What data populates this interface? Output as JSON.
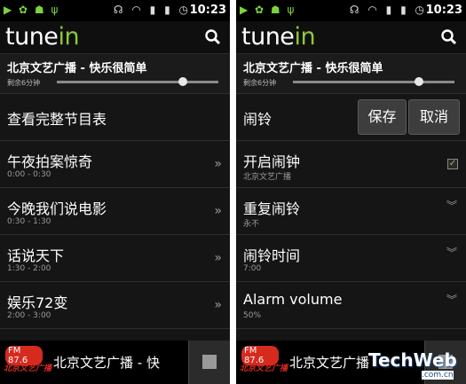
{
  "status": {
    "time": "10:23"
  },
  "brand": {
    "logo_main": "tune",
    "logo_accent": "in"
  },
  "now_playing": {
    "station": "北京文艺广播 - 快乐很简单",
    "remaining": "剩余6分钟",
    "progress": 0.78
  },
  "left": {
    "schedule_link": "查看完整节目表",
    "programs": [
      {
        "title": "午夜拍案惊奇",
        "time": "0:00 - 0:30"
      },
      {
        "title": "今晚我们说电影",
        "time": "0:30 - 1:30"
      },
      {
        "title": "话说天下",
        "time": "1:30 - 2:00"
      },
      {
        "title": "娱乐72变",
        "time": "2:00 - 3:00"
      }
    ],
    "footer_title": "北京文艺广播 - 快"
  },
  "right": {
    "alarm_label": "闹铃",
    "save_label": "保存",
    "cancel_label": "取消",
    "settings": [
      {
        "title": "开启闹钟",
        "sub": "北京文艺广播",
        "checked": true
      },
      {
        "title": "重复闹铃",
        "sub": "永不"
      },
      {
        "title": "闹铃时间",
        "sub": "7:00"
      },
      {
        "title": "Alarm volume",
        "sub": "50%"
      }
    ],
    "footer_title": "北京文艺广播"
  },
  "station_logo": {
    "fm": "FM 87.6",
    "call": "北京文艺广播"
  },
  "watermark": {
    "brand": "TechWeb",
    "domain": ".com.cn"
  },
  "colors": {
    "accent": "#8cc83c",
    "background": "#151515",
    "logo_red": "#d62a1f"
  }
}
